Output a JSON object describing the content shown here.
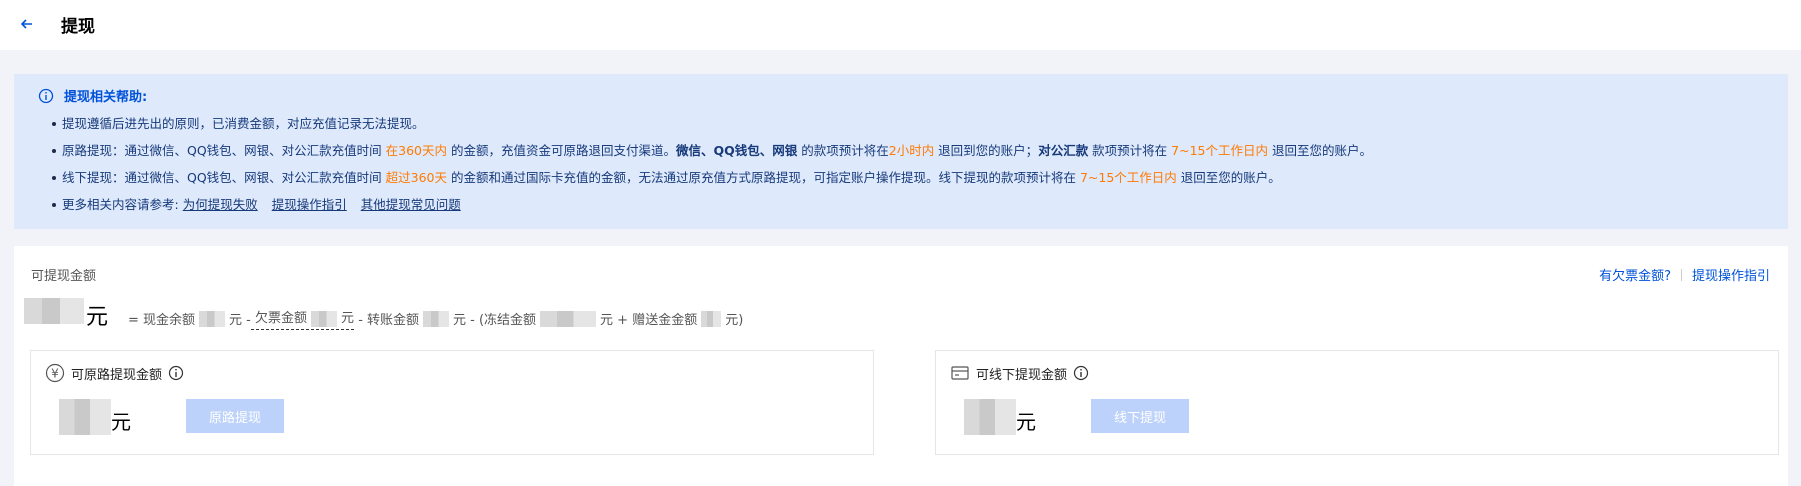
{
  "header": {
    "title": "提现"
  },
  "help": {
    "title": "提现相关帮助:",
    "line1": "提现遵循后进先出的原则，已消费金额，对应充值记录无法提现。",
    "line2": {
      "a": "原路提现：通过微信、QQ钱包、网银、对公汇款充值时间 ",
      "b": "在360天内",
      "c": " 的金额，充值资金可原路退回支付渠道。",
      "d": "微信、QQ钱包、网银",
      "e": " 的款项预计将在",
      "f": "2小时内",
      "g": " 退回到您的账户；",
      "h": "对公汇款",
      "i": " 款项预计将在 ",
      "j": "7~15个工作日内",
      "k": " 退回至您的账户。"
    },
    "line3": {
      "a": "线下提现：通过微信、QQ钱包、网银、对公汇款充值时间 ",
      "b": "超过360天",
      "c": " 的金额和通过国际卡充值的金额，无法通过原充值方式原路提现，可指定账户操作提现。线下提现的款项预计将在 ",
      "d": "7~15个工作日内",
      "e": " 退回至您的账户。"
    },
    "line4": {
      "prefix": "更多相关内容请参考: ",
      "links": [
        "为何提现失败",
        "提现操作指引",
        "其他提现常见问题"
      ]
    }
  },
  "panel": {
    "label": "可提现金额",
    "links": [
      "有欠票金额?",
      "提现操作指引"
    ],
    "unit": "元",
    "formula": {
      "eq": "= 现金余额",
      "u1": "元  -",
      "debt": "欠票金额",
      "u2": "元",
      "transfer": "- 转账金额",
      "u3": "元  - (冻结金额",
      "u4": "元  + 赠送金金额",
      "u5": "元)"
    }
  },
  "original": {
    "title": "可原路提现金额",
    "unit": "元",
    "button": "原路提现"
  },
  "offline": {
    "title": "可线下提现金额",
    "unit": "元",
    "button": "线下提现"
  },
  "colors": {
    "accent": "#0052d9",
    "highlight": "#ff7a00",
    "helpBg": "#dfe9fc",
    "disabledBtn": "#bcd2fa"
  }
}
